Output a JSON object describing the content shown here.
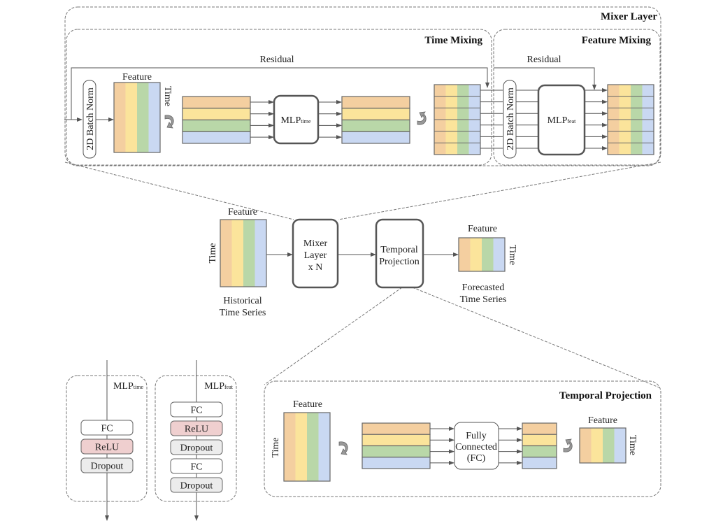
{
  "colors": {
    "orange": "#f4cfa0",
    "yellow": "#fbe49b",
    "green": "#b9d7a8",
    "blue": "#c9d8f2",
    "relu": "#efcfcf",
    "dropout": "#ececec"
  },
  "mixer_layer": {
    "title": "Mixer Layer",
    "time_mixing": {
      "title": "Time Mixing",
      "residual": "Residual",
      "batch_norm": "2D Batch Norm",
      "feature": "Feature",
      "time": "Time",
      "mlp": "MLP",
      "mlp_sub": "time"
    },
    "feature_mixing": {
      "title": "Feature Mixing",
      "residual": "Residual",
      "batch_norm": "2D Batch Norm",
      "mlp": "MLP",
      "mlp_sub": "feat"
    }
  },
  "pipeline": {
    "input": {
      "feature": "Feature",
      "time": "Time",
      "caption_1": "Historical",
      "caption_2": "Time Series"
    },
    "mixer": {
      "line_1": "Mixer",
      "line_2": "Layer",
      "line_3": "x N"
    },
    "projection": {
      "line_1": "Temporal",
      "line_2": "Projection"
    },
    "output": {
      "feature": "Feature",
      "time": "Time",
      "caption_1": "Forecasted",
      "caption_2": "Time Series"
    }
  },
  "temporal_projection": {
    "title": "Temporal Projection",
    "feature": "Feature",
    "time": "Time",
    "fc_1": "Fully",
    "fc_2": "Connected",
    "fc_3": "(FC)",
    "out_feature": "Feature",
    "out_time": "Time"
  },
  "mlp_time": {
    "title": "MLP",
    "sub": "time",
    "layers": [
      "FC",
      "ReLU",
      "Dropout"
    ]
  },
  "mlp_feat": {
    "title": "MLP",
    "sub": "feat",
    "layers": [
      "FC",
      "ReLU",
      "Dropout",
      "FC",
      "Dropout"
    ]
  }
}
